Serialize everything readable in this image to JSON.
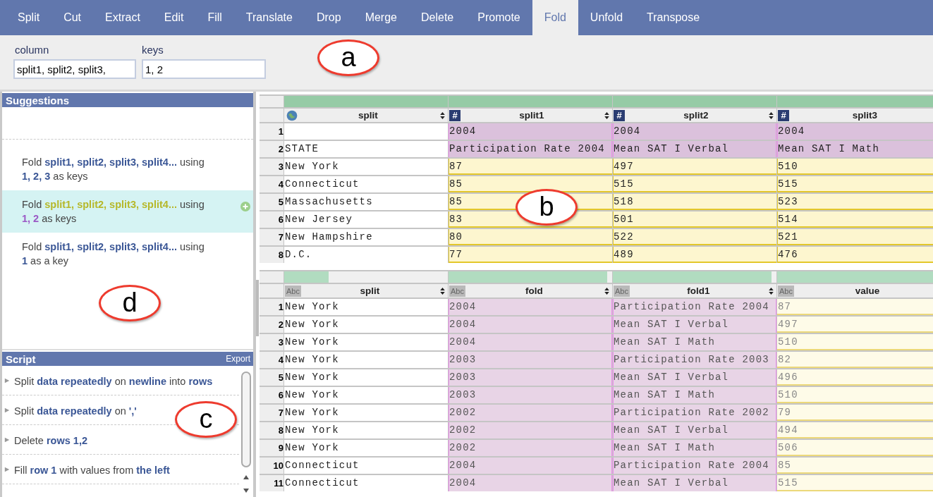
{
  "tabs": [
    {
      "label": "Split",
      "selected": false
    },
    {
      "label": "Cut",
      "selected": false
    },
    {
      "label": "Extract",
      "selected": false
    },
    {
      "label": "Edit",
      "selected": false
    },
    {
      "label": "Fill",
      "selected": false
    },
    {
      "label": "Translate",
      "selected": false
    },
    {
      "label": "Drop",
      "selected": false
    },
    {
      "label": "Merge",
      "selected": false
    },
    {
      "label": "Delete",
      "selected": false
    },
    {
      "label": "Promote",
      "selected": false
    },
    {
      "label": "Fold",
      "selected": true
    },
    {
      "label": "Unfold",
      "selected": false
    },
    {
      "label": "Transpose",
      "selected": false
    }
  ],
  "options": [
    {
      "label": "column",
      "value": "split1, split2, split3,"
    },
    {
      "label": "keys",
      "value": "1, 2"
    }
  ],
  "suggestions": {
    "title": "Suggestions",
    "items": [
      {
        "text": "Fold **split1, split2, split3, split4...** using **1, 2, 3** as keys",
        "selected": false
      },
      {
        "text": "Fold **split1, split2, split3, split4...** using **1, 2** as keys",
        "selected": true
      },
      {
        "text": "Fold **split1, split2, split3, split4...** using **1** as a key",
        "selected": false
      }
    ]
  },
  "script": {
    "title": "Script",
    "export": "Export",
    "items": [
      {
        "text": "Split **data repeatedly** on **newline** into **rows**"
      },
      {
        "text": "Split **data repeatedly** on **','**"
      },
      {
        "text": "Delete **rows 1,2**"
      },
      {
        "text": "Fill **row 1** with values from **the left**"
      }
    ]
  },
  "tables": [
    {
      "kind": "preview",
      "columns": [
        {
          "name": "split",
          "kind": "geo",
          "level": 1,
          "sortable": true
        },
        {
          "name": "split1",
          "kind": "number",
          "type_label": "#",
          "level": 1,
          "sortable": true
        },
        {
          "name": "split2",
          "kind": "number",
          "type_label": "#",
          "level": 1,
          "sortable": true
        },
        {
          "name": "split3",
          "kind": "number",
          "type_label": "#",
          "level": 1,
          "sortable": false
        }
      ],
      "rows": [
        {
          "number": "1",
          "kind": "key",
          "cells": [
            "",
            "2004",
            "2004",
            "2004"
          ]
        },
        {
          "number": "2",
          "kind": "key",
          "cells": [
            "STATE",
            "Participation Rate 2004",
            "Mean SAT I Verbal",
            "Mean SAT I Math"
          ]
        },
        {
          "number": "3",
          "kind": "value",
          "cells": [
            "New York",
            "87",
            "497",
            "510"
          ]
        },
        {
          "number": "4",
          "kind": "value",
          "cells": [
            "Connecticut",
            "85",
            "515",
            "515"
          ]
        },
        {
          "number": "5",
          "kind": "value",
          "cells": [
            "Massachusetts",
            "85",
            "518",
            "523"
          ]
        },
        {
          "number": "6",
          "kind": "value",
          "cells": [
            "New Jersey",
            "83",
            "501",
            "514"
          ]
        },
        {
          "number": "7",
          "kind": "value",
          "cells": [
            "New Hampshire",
            "80",
            "522",
            "521"
          ]
        },
        {
          "number": "8",
          "kind": "value",
          "cells": [
            "D.C.",
            "77",
            "489",
            "476"
          ]
        }
      ]
    },
    {
      "kind": "result",
      "columns": [
        {
          "name": "split",
          "kind": "string",
          "type_label": "Abc",
          "level": 0.27,
          "sortable": true
        },
        {
          "name": "fold",
          "kind": "string",
          "type_label": "Abc",
          "level": 0.97,
          "sortable": true
        },
        {
          "name": "fold1",
          "kind": "string",
          "type_label": "Abc",
          "level": 0.97,
          "sortable": true
        },
        {
          "name": "value",
          "kind": "string",
          "type_label": "Abc",
          "level": 1,
          "sortable": false
        }
      ],
      "rows": [
        {
          "number": "1",
          "cells": [
            "New York",
            "2004",
            "Participation Rate 2004",
            "87"
          ]
        },
        {
          "number": "2",
          "cells": [
            "New York",
            "2004",
            "Mean SAT I Verbal",
            "497"
          ]
        },
        {
          "number": "3",
          "cells": [
            "New York",
            "2004",
            "Mean SAT I Math",
            "510"
          ]
        },
        {
          "number": "4",
          "cells": [
            "New York",
            "2003",
            "Participation Rate 2003",
            "82"
          ]
        },
        {
          "number": "5",
          "cells": [
            "New York",
            "2003",
            "Mean SAT I Verbal",
            "496"
          ]
        },
        {
          "number": "6",
          "cells": [
            "New York",
            "2003",
            "Mean SAT I Math",
            "510"
          ]
        },
        {
          "number": "7",
          "cells": [
            "New York",
            "2002",
            "Participation Rate 2002",
            "79"
          ]
        },
        {
          "number": "8",
          "cells": [
            "New York",
            "2002",
            "Mean SAT I Verbal",
            "494"
          ]
        },
        {
          "number": "9",
          "cells": [
            "New York",
            "2002",
            "Mean SAT I Math",
            "506"
          ]
        },
        {
          "number": "10",
          "cells": [
            "Connecticut",
            "2004",
            "Participation Rate 2004",
            "85"
          ]
        },
        {
          "number": "11",
          "cells": [
            "Connecticut",
            "2004",
            "Mean SAT I Verbal",
            "515"
          ]
        }
      ]
    }
  ],
  "callouts": [
    {
      "label": "a",
      "kind": "options"
    },
    {
      "label": "b",
      "kind": "table"
    },
    {
      "label": "c",
      "kind": "script"
    },
    {
      "label": "d",
      "kind": "suggestions"
    }
  ]
}
